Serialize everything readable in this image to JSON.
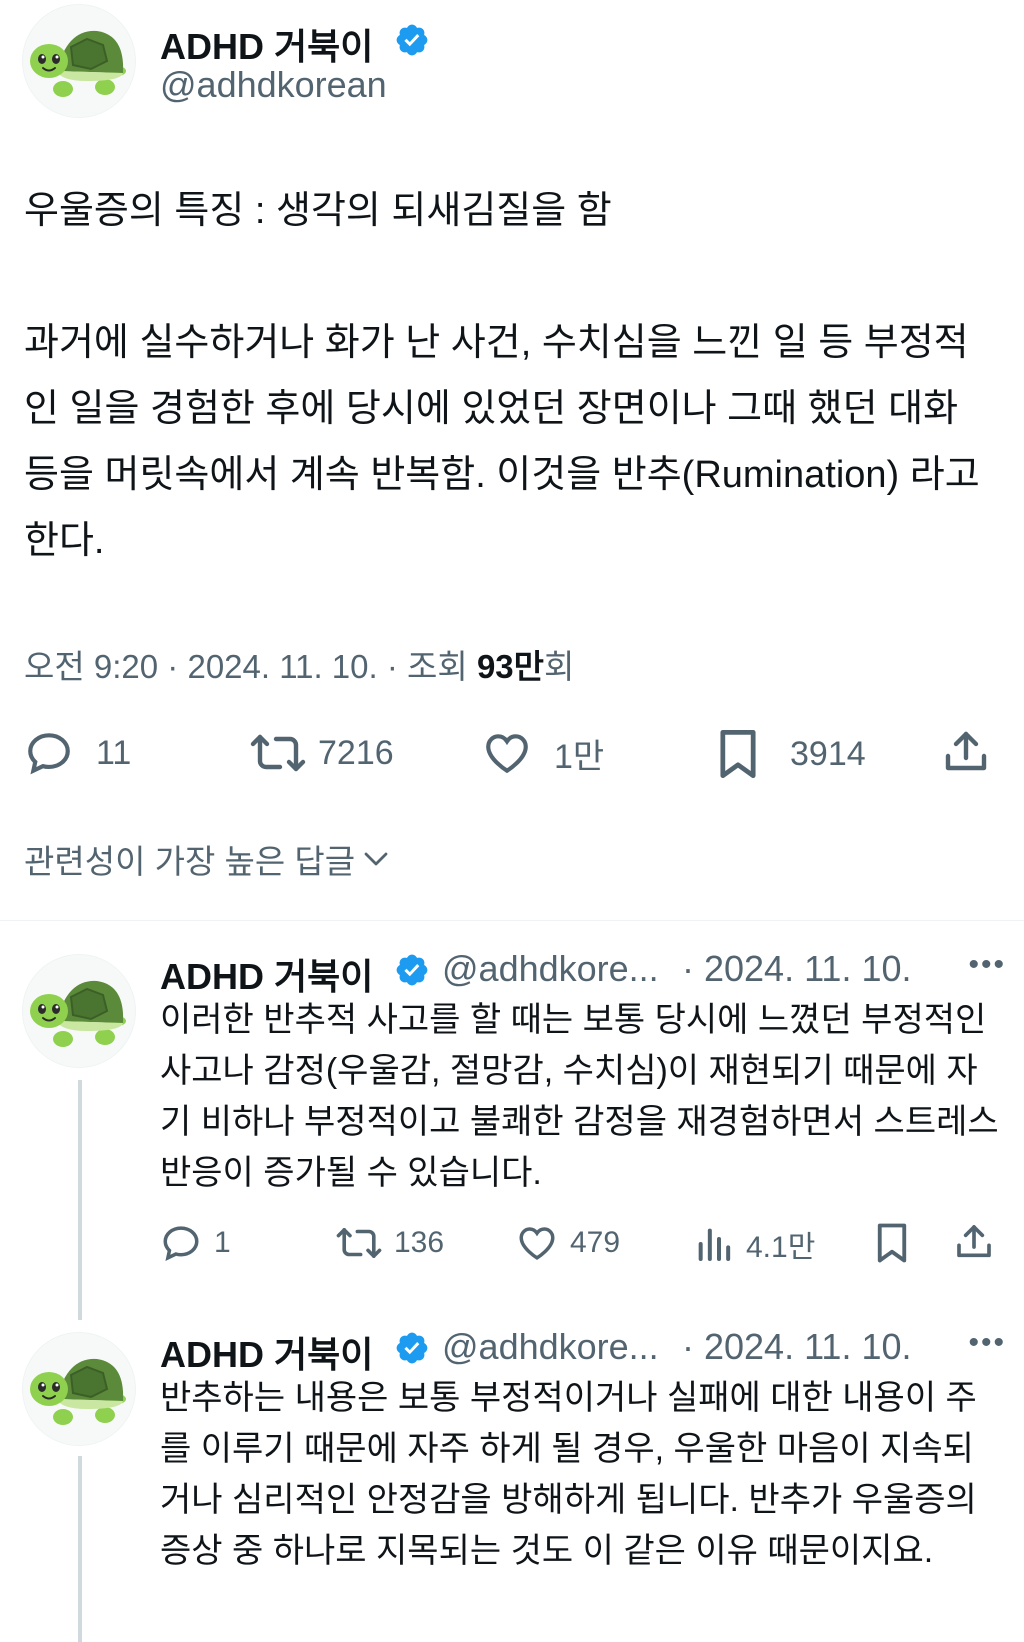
{
  "tweet": {
    "author_name": "ADHD 거북이",
    "author_handle": "@adhdkorean",
    "avatar_icon": "turtle-emoji-icon",
    "verified_icon": "verified-badge-icon",
    "text_title": "우울증의 특징 : 생각의 되새김질을 함",
    "text_body": "과거에 실수하거나 화가 난 사건, 수치심을 느낀 일 등 부정적인 일을 경험한 후에 당시에 있었던 장면이나 그때 했던 대화 등을 머릿속에서 계속 반복함. 이것을 반추(Rumination) 라고 한다.",
    "time": "오전 9:20",
    "date": "2024. 11. 10.",
    "views_label": "조회",
    "views_number": "93",
    "views_unit": "만",
    "views_suffix": "회",
    "separator": "·",
    "actions": {
      "replies": "11",
      "retweets": "7216",
      "likes": "1만",
      "bookmarks": "3914"
    }
  },
  "sort_label": "관련성이 가장 높은 답글",
  "replies": [
    {
      "author_name": "ADHD 거북이",
      "author_handle": "@adhdkore...",
      "date": "· 2024. 11. 10.",
      "text": "이러한 반추적 사고를 할 때는 보통 당시에 느꼈던 부정적인 사고나 감정(우울감, 절망감, 수치심)이 재현되기 때문에 자기 비하나 부정적이고 불쾌한 감정을 재경험하면서 스트레스 반응이 증가될 수 있습니다.",
      "actions": {
        "replies": "1",
        "retweets": "136",
        "likes": "479",
        "views": "4.1만"
      }
    },
    {
      "author_name": "ADHD 거북이",
      "author_handle": "@adhdkore...",
      "date": "· 2024. 11. 10.",
      "text": "반추하는 내용은 보통 부정적이거나 실패에 대한 내용이 주를 이루기 때문에 자주 하게 될 경우, 우울한 마음이 지속되거나 심리적인 안정감을 방해하게 됩니다. 반추가 우울증의 증상 중 하나로 지목되는 것도 이 같은 이유 때문이지요."
    }
  ],
  "more_icon": "more-dots-icon",
  "colors": {
    "text": "#0f1419",
    "secondary": "#536471",
    "verified": "#1d9bf0",
    "thread_line": "#cfd9de"
  }
}
